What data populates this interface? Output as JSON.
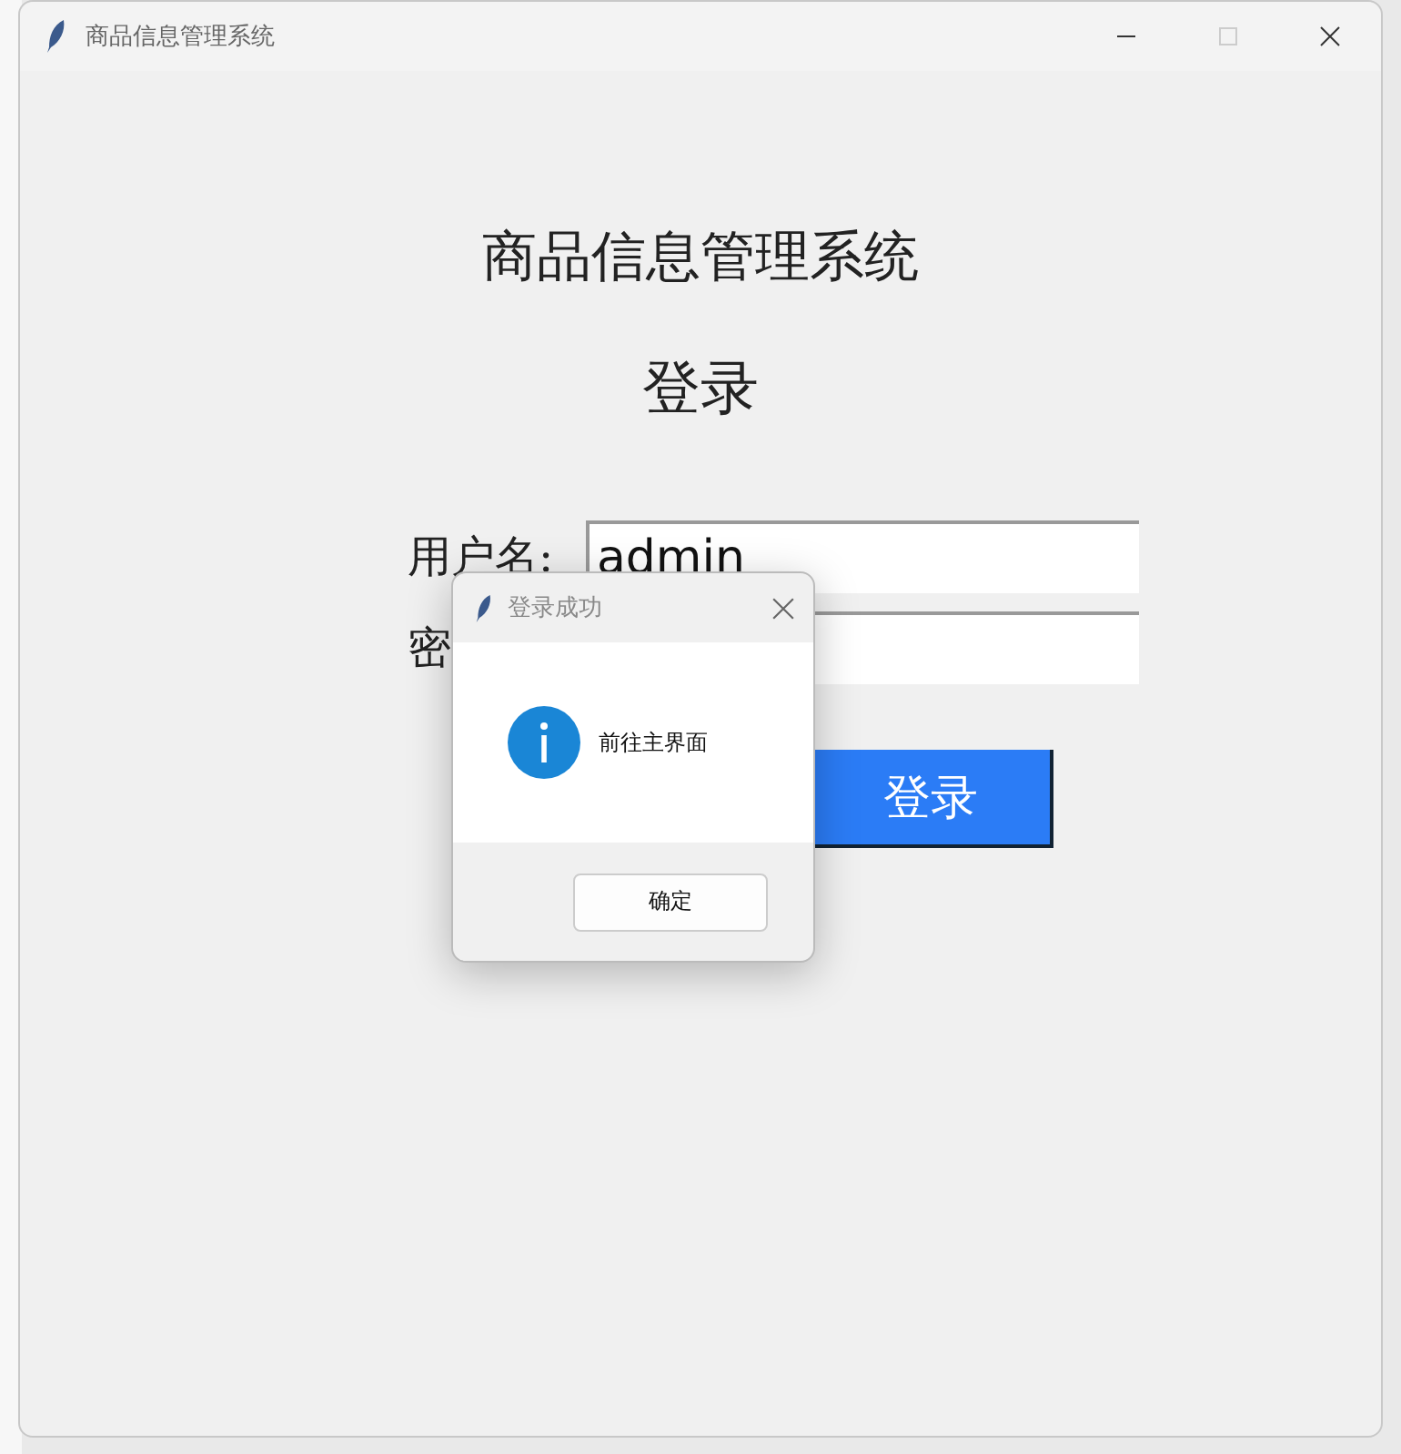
{
  "window": {
    "title": "商品信息管理系统"
  },
  "heading": "商品信息管理系统",
  "subheading": "登录",
  "form": {
    "fields": [
      {
        "label": "用户名:",
        "value": "admin"
      },
      {
        "label": "密"
      }
    ],
    "submit": "登录"
  },
  "dialog": {
    "title": "登录成功",
    "message": "前往主界面",
    "button": "确定"
  }
}
